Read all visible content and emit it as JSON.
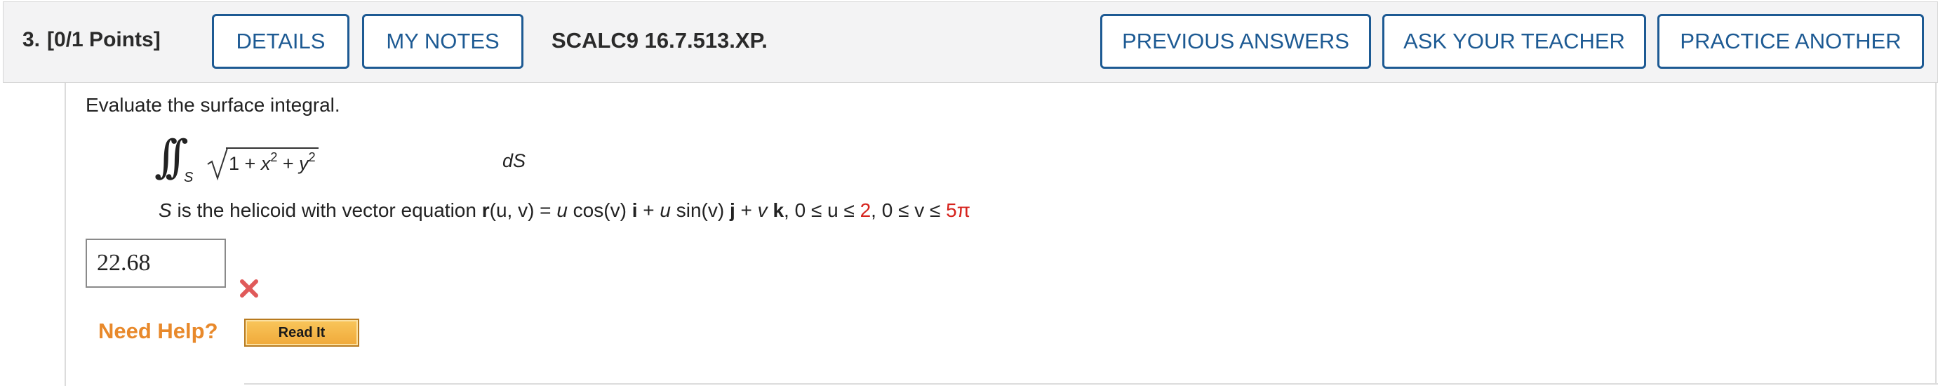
{
  "question": {
    "number": "3.",
    "points": "[0/1 Points]",
    "id": "SCALC9 16.7.513.XP."
  },
  "buttons": {
    "details": "DETAILS",
    "my_notes": "MY NOTES",
    "previous_answers": "PREVIOUS ANSWERS",
    "ask_teacher": "ASK YOUR TEACHER",
    "practice_another": "PRACTICE ANOTHER"
  },
  "problem": {
    "prompt": "Evaluate the surface integral.",
    "integral_subscript": "S",
    "radicand": {
      "one": "1",
      "plus1": "+",
      "x": "x",
      "x_exp": "2",
      "plus2": "+",
      "y": "y",
      "y_exp": "2"
    },
    "differential": "dS",
    "surface": {
      "s": "S",
      "text1": " is the helicoid with vector equation ",
      "r": "r",
      "args": "(u, v) = ",
      "u1": "u",
      "cos": " cos(v) ",
      "i": "i",
      "plus1": " + ",
      "u2": "u",
      "sin": " sin(v) ",
      "j": "j",
      "plus2": " + ",
      "v": "v",
      "k": "k",
      "range_u": ", 0 ≤ u ≤ ",
      "u_max": "2",
      "range_v": ", 0 ≤ v ≤ ",
      "v_max": "5π"
    }
  },
  "answer": {
    "value": "22.68",
    "status": "incorrect",
    "status_icon": "x-mark-icon",
    "status_color": "#e05a5a"
  },
  "help": {
    "label": "Need Help?",
    "read_it": "Read It"
  },
  "colors": {
    "button_border": "#1d5a93",
    "header_bg": "#f3f3f4",
    "help_orange": "#e8892b",
    "highlight_red": "#d6231d"
  }
}
